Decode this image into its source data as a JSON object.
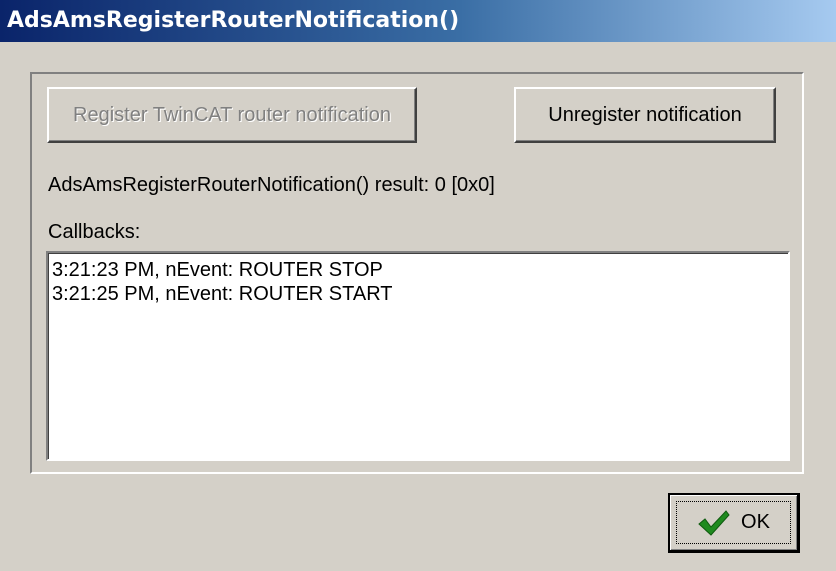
{
  "window": {
    "title": "AdsAmsRegisterRouterNotification()"
  },
  "buttons": {
    "register_label": "Register TwinCAT router notification",
    "unregister_label": "Unregister notification",
    "ok_label": "OK"
  },
  "status": {
    "result_text": "AdsAmsRegisterRouterNotification() result: 0 [0x0]"
  },
  "callbacks": {
    "label": "Callbacks:",
    "items": [
      "3:21:23 PM, nEvent: ROUTER STOP",
      "3:21:25 PM, nEvent: ROUTER START"
    ]
  },
  "icons": {
    "ok_icon": "checkmark-icon",
    "ok_icon_color": "#1f8a1f"
  },
  "colors": {
    "dialog_face": "#d4d0c8",
    "title_gradient_start": "#0a246a",
    "title_gradient_end": "#a6caf0",
    "disabled_text": "#808080"
  }
}
